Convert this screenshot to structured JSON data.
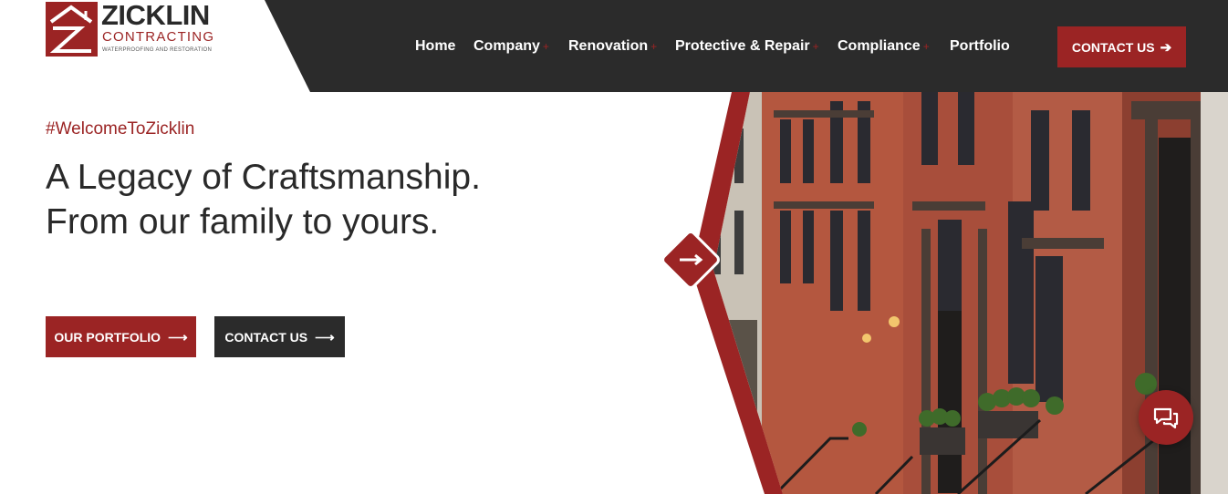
{
  "brand": {
    "name": "ZICKLIN",
    "sub": "CONTRACTING",
    "tagline": "WATERPROOFING AND RESTORATION",
    "accent_color": "#9b2424",
    "dark_color": "#2b2b2b"
  },
  "nav": {
    "items": [
      {
        "label": "Home",
        "has_submenu": false
      },
      {
        "label": "Company",
        "has_submenu": true
      },
      {
        "label": "Renovation",
        "has_submenu": true
      },
      {
        "label": "Protective & Repair",
        "has_submenu": true
      },
      {
        "label": "Compliance",
        "has_submenu": true
      },
      {
        "label": "Portfolio",
        "has_submenu": false
      }
    ],
    "submenu_indicator": "+",
    "contact_label": "CONTACT US",
    "contact_icon": "arrow-right-icon"
  },
  "hero": {
    "hashtag": "#WelcomeToZicklin",
    "headline": "A Legacy of Craftsmanship. From our family to yours.",
    "primary_button": "OUR PORTFOLIO",
    "secondary_button": "CONTACT US",
    "button_icon": "arrow-right-icon",
    "image_subject": "brick-townhouse-facades",
    "slider_icon": "arrow-right-icon"
  },
  "chat": {
    "icon": "chat-bubbles-icon"
  }
}
